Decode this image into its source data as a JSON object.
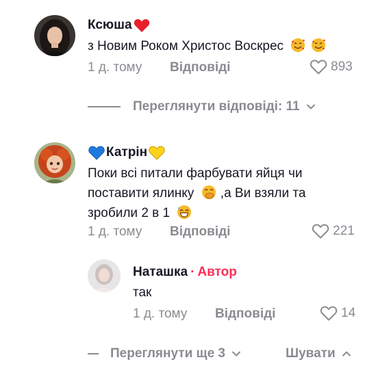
{
  "comments": [
    {
      "author": "Ксюша",
      "text": "з Новим Роком Христос Воскрес",
      "time": "1 д. тому",
      "reply_label": "Відповіді",
      "likes": "893",
      "avatar_icon": "woman-portrait-dark-hair",
      "name_suffix_icon": "red-heart-icon",
      "text_emojis": [
        "smiling-face-with-hearts-icon",
        "smiling-face-with-hearts-icon"
      ],
      "view_replies": "Переглянути відповіді: 11"
    },
    {
      "author": "Катрін",
      "text_line1": "Поки всі питали фарбувати яйця чи",
      "text_line2a": "поставити ялинку",
      "text_line2b": ",а Ви взяли та",
      "text_line3": "зробили 2 в 1",
      "time": "1 д. тому",
      "reply_label": "Відповіді",
      "likes": "221",
      "avatar_icon": "red-haired-cartoon-girl",
      "name_prefix_icon": "blue-heart-icon",
      "name_suffix_icon": "yellow-heart-icon",
      "text_emojis": [
        "face-with-hand-over-mouth-icon",
        "grinning-face-with-sweat-icon"
      ]
    }
  ],
  "reply": {
    "author": "Наташка",
    "separator": "·",
    "author_badge": "Автор",
    "text": "так",
    "time": "1 д. тому",
    "reply_label": "Відповіді",
    "likes": "14",
    "avatar_icon": "woman-portrait-light"
  },
  "footer": {
    "view_more": "Переглянути ще 3",
    "collapse": "Шувати"
  },
  "colors": {
    "text": "#161823",
    "muted": "#8a8b91",
    "author_badge": "#fe2c55"
  }
}
